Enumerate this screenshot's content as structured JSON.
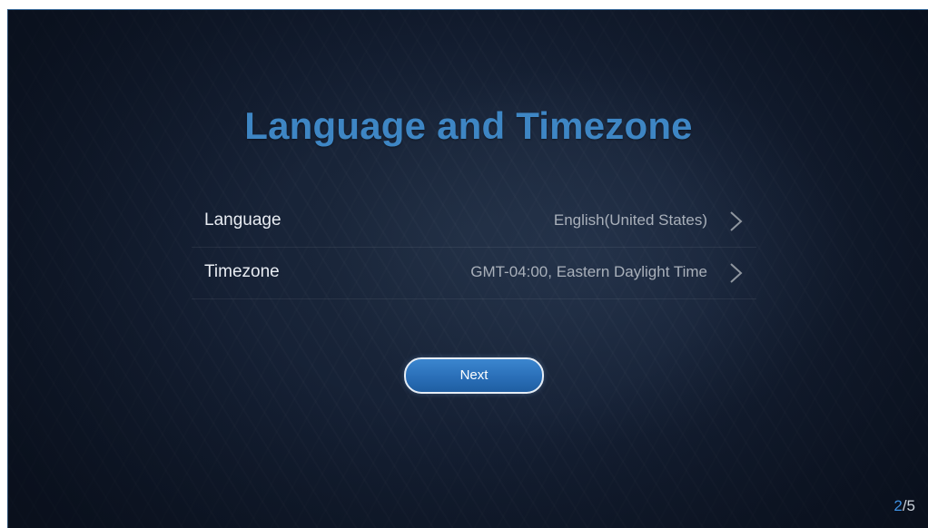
{
  "title": "Language and Timezone",
  "settings": [
    {
      "label": "Language",
      "value": "English(United States)",
      "icon": "chevron-right-icon"
    },
    {
      "label": "Timezone",
      "value": "GMT-04:00, Eastern Daylight Time",
      "icon": "chevron-right-icon"
    }
  ],
  "next_button": {
    "label": "Next"
  },
  "pager": {
    "current": "2",
    "total": "/5"
  },
  "colors": {
    "title": "#3e86c4",
    "button": "#2a6fb8",
    "pager_current": "#3e8fe0",
    "background": "#152034"
  }
}
